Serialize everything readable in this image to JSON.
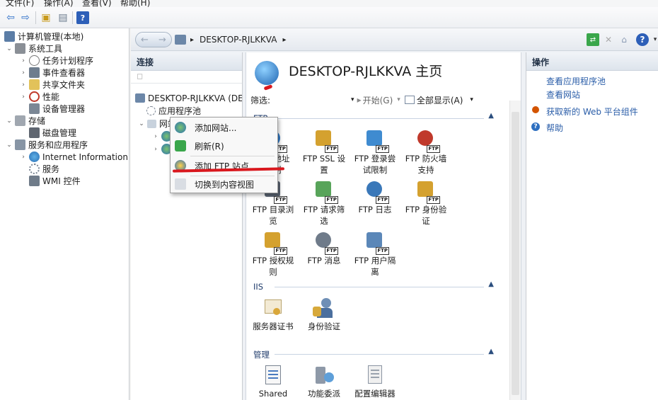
{
  "menubar": {
    "items": [
      "文件(F)",
      "操作(A)",
      "查看(V)",
      "帮助(H)"
    ]
  },
  "left_tree": {
    "items": [
      {
        "label": "计算机管理(本地)",
        "level": 0,
        "expander": ""
      },
      {
        "label": "系统工具",
        "level": 1,
        "expander": "v"
      },
      {
        "label": "任务计划程序",
        "level": 2,
        "expander": ">"
      },
      {
        "label": "事件查看器",
        "level": 2,
        "expander": ">"
      },
      {
        "label": "共享文件夹",
        "level": 2,
        "expander": ">"
      },
      {
        "label": "性能",
        "level": 2,
        "expander": ">"
      },
      {
        "label": "设备管理器",
        "level": 2,
        "expander": ""
      },
      {
        "label": "存储",
        "level": 1,
        "expander": "v"
      },
      {
        "label": "磁盘管理",
        "level": 2,
        "expander": ""
      },
      {
        "label": "服务和应用程序",
        "level": 1,
        "expander": "v"
      },
      {
        "label": "Internet Information S",
        "level": 2,
        "expander": ">"
      },
      {
        "label": "服务",
        "level": 2,
        "expander": ""
      },
      {
        "label": "WMI 控件",
        "level": 2,
        "expander": ""
      }
    ]
  },
  "address": {
    "path": "DESKTOP-RJLKKVA",
    "separator": "▸"
  },
  "connections": {
    "title": "连接",
    "tree": [
      {
        "label": "DESKTOP-RJLKKVA (DE"
      },
      {
        "label": "应用程序池"
      },
      {
        "label": "网站"
      }
    ]
  },
  "context_menu": {
    "items": [
      {
        "label": "添加网站..."
      },
      {
        "label": "刷新(R)"
      },
      {
        "label": "添加 FTP 站点..."
      },
      {
        "label": "切换到内容视图"
      }
    ]
  },
  "center": {
    "title": "DESKTOP-RJLKKVA 主页",
    "filter_label": "筛选:",
    "start_label": "开始(G)",
    "showall_label": "全部显示(A)",
    "sections": {
      "ftp": "FTP",
      "iis": "IIS",
      "manage": "管理"
    },
    "ftp_features": [
      "FTP 地址\n限制",
      "FTP SSL 设\n置",
      "FTP 登录尝\n试限制",
      "FTP 防火墙\n支持",
      "FTP 目录浏\n览",
      "FTP 请求筛\n选",
      "FTP 日志",
      "FTP 身份验\n证",
      "FTP 授权规\n则",
      "FTP 消息",
      "FTP 用户隔\n离"
    ],
    "iis_features": [
      "服务器证书",
      "身份验证"
    ],
    "manage_features": [
      "Shared",
      "功能委派",
      "配置编辑器"
    ]
  },
  "actions": {
    "title": "操作",
    "items": [
      "查看应用程序池",
      "查看网站",
      "获取新的 Web 平台组件",
      "帮助"
    ]
  },
  "colors": {
    "link": "#2a5da8",
    "annotation": "#d9181e"
  }
}
